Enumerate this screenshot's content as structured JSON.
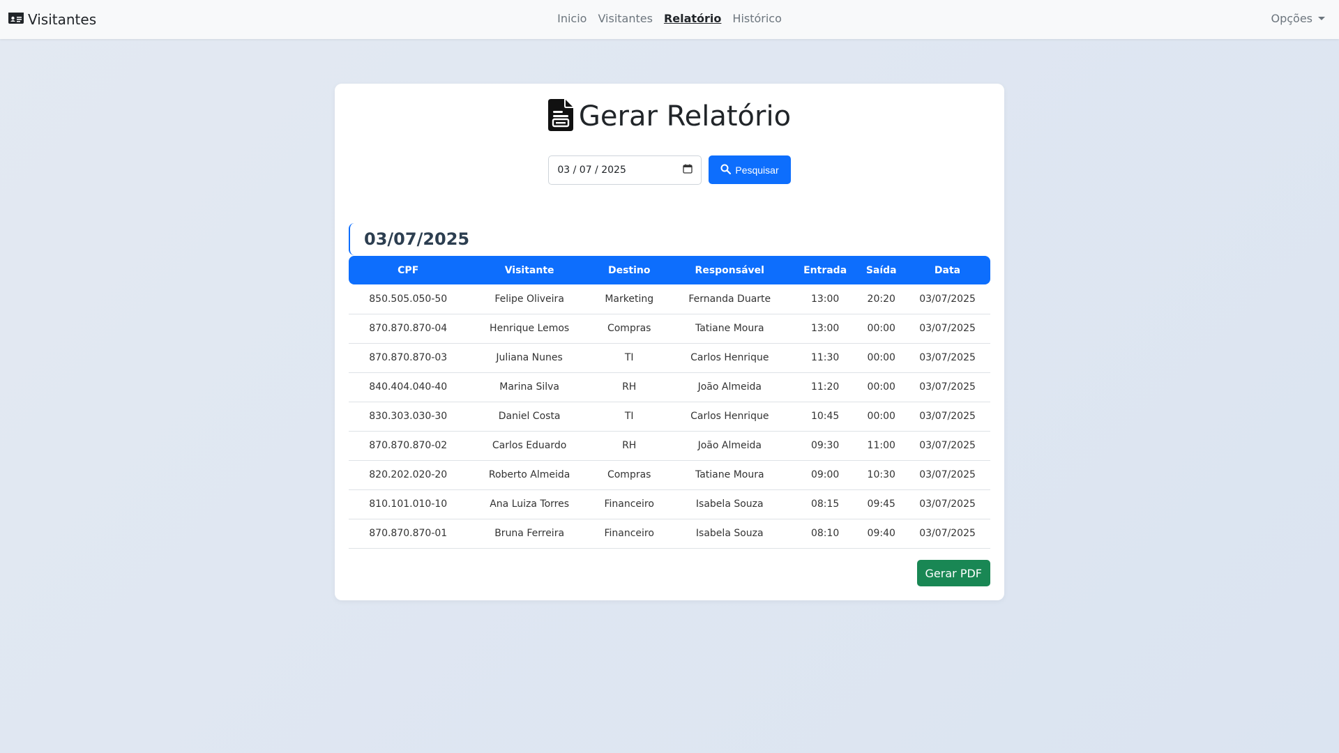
{
  "navbar": {
    "brand": "Visitantes",
    "links": [
      "Inicio",
      "Visitantes",
      "Relatório",
      "Histórico"
    ],
    "active_link": "Relatório",
    "options_label": "Opções"
  },
  "report": {
    "title": "Gerar Relatório",
    "date_input_value": "03 / 07 / 2025",
    "search_button": "Pesquisar",
    "date_heading": "03/07/2025",
    "pdf_button": "Gerar PDF"
  },
  "table": {
    "headers": [
      "CPF",
      "Visitante",
      "Destino",
      "Responsável",
      "Entrada",
      "Saída",
      "Data"
    ],
    "rows": [
      [
        "850.505.050-50",
        "Felipe Oliveira",
        "Marketing",
        "Fernanda Duarte",
        "13:00",
        "20:20",
        "03/07/2025"
      ],
      [
        "870.870.870-04",
        "Henrique Lemos",
        "Compras",
        "Tatiane Moura",
        "13:00",
        "00:00",
        "03/07/2025"
      ],
      [
        "870.870.870-03",
        "Juliana Nunes",
        "TI",
        "Carlos Henrique",
        "11:30",
        "00:00",
        "03/07/2025"
      ],
      [
        "840.404.040-40",
        "Marina Silva",
        "RH",
        "João Almeida",
        "11:20",
        "00:00",
        "03/07/2025"
      ],
      [
        "830.303.030-30",
        "Daniel Costa",
        "TI",
        "Carlos Henrique",
        "10:45",
        "00:00",
        "03/07/2025"
      ],
      [
        "870.870.870-02",
        "Carlos Eduardo",
        "RH",
        "João Almeida",
        "09:30",
        "11:00",
        "03/07/2025"
      ],
      [
        "820.202.020-20",
        "Roberto Almeida",
        "Compras",
        "Tatiane Moura",
        "09:00",
        "10:30",
        "03/07/2025"
      ],
      [
        "810.101.010-10",
        "Ana Luiza Torres",
        "Financeiro",
        "Isabela Souza",
        "08:15",
        "09:45",
        "03/07/2025"
      ],
      [
        "870.870.870-01",
        "Bruna Ferreira",
        "Financeiro",
        "Isabela Souza",
        "08:10",
        "09:40",
        "03/07/2025"
      ]
    ]
  },
  "colors": {
    "primary": "#0d6efd",
    "success": "#198754"
  }
}
